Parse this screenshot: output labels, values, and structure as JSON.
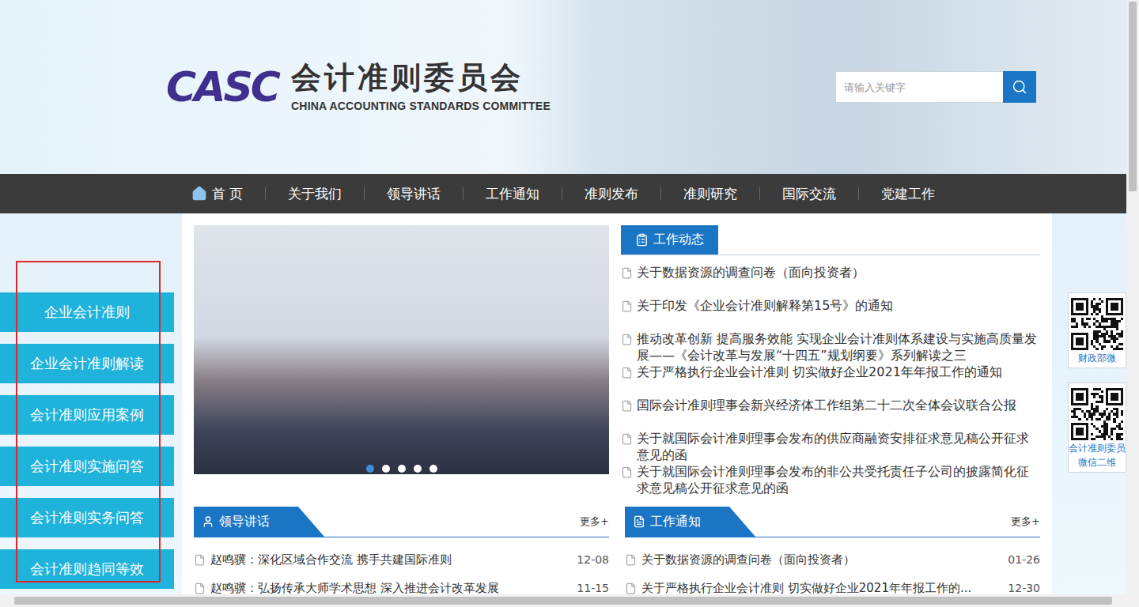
{
  "header": {
    "logo_mark": "CASC",
    "title": "会计准则委员会",
    "subtitle": "CHINA ACCOUNTING STANDARDS COMMITTEE",
    "search": {
      "placeholder": "请输入关键字"
    }
  },
  "nav": [
    {
      "label": "首 页",
      "kind": "home"
    },
    {
      "label": "关于我们",
      "kind": "link"
    },
    {
      "label": "领导讲话",
      "kind": "link"
    },
    {
      "label": "工作通知",
      "kind": "link"
    },
    {
      "label": "准则发布",
      "kind": "link"
    },
    {
      "label": "准则研究",
      "kind": "link"
    },
    {
      "label": "国际交流",
      "kind": "link"
    },
    {
      "label": "党建工作",
      "kind": "link"
    }
  ],
  "sidebar": {
    "outlined": true,
    "items": [
      "企业会计准则",
      "企业会计准则解读",
      "会计准则应用案例",
      "会计准则实施问答",
      "会计准则实务问答",
      "会计准则趋同等效"
    ]
  },
  "carousel": {
    "dots": [
      {
        "selected": true
      },
      {
        "selected": false
      },
      {
        "selected": false
      },
      {
        "selected": false
      },
      {
        "selected": false
      }
    ]
  },
  "news": {
    "title": "工作动态",
    "items": [
      "关于数据资源的调查问卷（面向投资者）",
      "关于印发《企业会计准则解释第15号》的通知",
      "推动改革创新 提高服务效能 实现企业会计准则体系建设与实施高质量发展——《会计改革与发展“十四五”规划纲要》系列解读之三",
      "关于严格执行企业会计准则 切实做好企业2021年年报工作的通知",
      "国际会计准则理事会新兴经济体工作组第二十二次全体会议联合公报",
      "关于就国际会计准则理事会发布的供应商融资安排征求意见稿公开征求意见的函",
      "关于就国际会计准则理事会发布的非公共受托责任子公司的披露简化征求意见稿公开征求意见的函"
    ]
  },
  "panels": [
    {
      "title": "领导讲话",
      "kind": "speech",
      "more": "更多+",
      "rows": [
        {
          "text": "赵鸣骥：深化区域合作交流 携手共建国际准则",
          "date": "12-08"
        },
        {
          "text": "赵鸣骥：弘扬传承大师学术思想 深入推进会计改革发展",
          "date": "11-15"
        }
      ]
    },
    {
      "title": "工作通知",
      "kind": "notice",
      "more": "更多+",
      "rows": [
        {
          "text": "关于数据资源的调查问卷（面向投资者）",
          "date": "01-26"
        },
        {
          "text": "关于严格执行企业会计准则 切实做好企业2021年年报工作的...",
          "date": "12-30"
        }
      ]
    }
  ],
  "qr_cards": [
    {
      "lines": [
        "财政部微"
      ]
    },
    {
      "lines": [
        "会计准则委员",
        "微信二维"
      ]
    }
  ]
}
